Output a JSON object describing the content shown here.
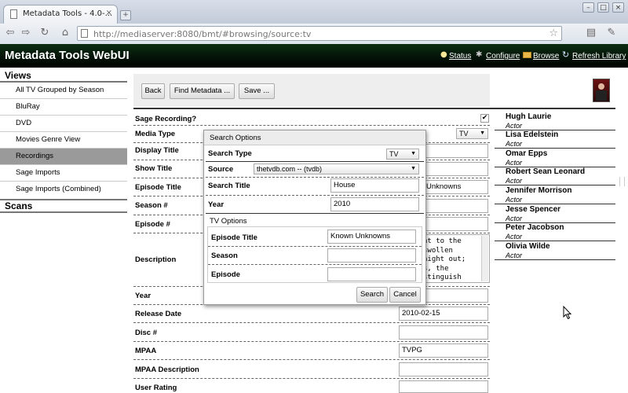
{
  "browser": {
    "tab_title": "Metadata Tools - 4.0-...",
    "tab_close": "×",
    "new_tab": "+",
    "url_host": "http://mediaserver",
    "url_path": ":8080/bmt/#browsing/source:tv"
  },
  "app": {
    "title": "Metadata Tools WebUI",
    "links": {
      "status": "Status",
      "configure": "Configure",
      "browse": "Browse",
      "refresh": "Refresh Library"
    }
  },
  "sidebar": {
    "views_heading": "Views",
    "items": [
      {
        "label": "All TV Grouped by Season"
      },
      {
        "label": "BluRay"
      },
      {
        "label": "DVD"
      },
      {
        "label": "Movies Genre View"
      },
      {
        "label": "Recordings",
        "selected": true
      },
      {
        "label": "Sage Imports"
      },
      {
        "label": "Sage Imports (Combined)"
      }
    ],
    "scans_heading": "Scans"
  },
  "toolbar": {
    "back": "Back",
    "find_metadata": "Find Metadata ...",
    "save": "Save ..."
  },
  "fields": {
    "sage_recording": "Sage Recording?",
    "sage_recording_checked": true,
    "checkmark": "✔",
    "media_type": "Media Type",
    "media_type_value": "TV",
    "display_title": "Display Title",
    "show_title": "Show Title",
    "episode_title": "Episode Title",
    "episode_title_value_partial": "Unknowns",
    "season": "Season #",
    "episode": "Episode #",
    "description": "Description",
    "description_lines": [
      "ht to the",
      "swollen",
      " night out;",
      "s, the",
      "stinguish"
    ],
    "year": "Year",
    "release_date": "Release Date",
    "release_date_value": "2010-02-15",
    "disc": "Disc #",
    "mpaa": "MPAA",
    "mpaa_value": "TVPG",
    "mpaa_description": "MPAA Description",
    "user_rating": "User Rating"
  },
  "cast": [
    {
      "name": "Hugh Laurie",
      "role": "Actor"
    },
    {
      "name": "Lisa Edelstein",
      "role": "Actor"
    },
    {
      "name": "Omar Epps",
      "role": "Actor"
    },
    {
      "name": "Robert Sean Leonard",
      "role": "Actor"
    },
    {
      "name": "Jennifer Morrison",
      "role": "Actor"
    },
    {
      "name": "Jesse Spencer",
      "role": "Actor"
    },
    {
      "name": "Peter Jacobson",
      "role": "Actor"
    },
    {
      "name": "Olivia Wilde",
      "role": "Actor"
    }
  ],
  "dialog": {
    "title": "Search Options",
    "search_type_label": "Search Type",
    "search_type_value": "TV",
    "source_label": "Source",
    "source_value": "thetvdb.com -- (tvdb)",
    "search_title_label": "Search Title",
    "search_title_value": "House",
    "year_label": "Year",
    "year_value": "2010",
    "tv_options_heading": "TV Options",
    "episode_title_label": "Episode Title",
    "episode_title_value": "Known Unknowns",
    "season_label": "Season",
    "season_value": "",
    "episode_label": "Episode",
    "episode_value": "",
    "search_button": "Search",
    "cancel_button": "Cancel"
  },
  "colors": {
    "header_bg": "#0b2d12",
    "selected_item": "#9a9a9a",
    "link": "#ffffff"
  },
  "icons": [
    "document-icon",
    "back-arrow-icon",
    "forward-arrow-icon",
    "reload-icon",
    "home-icon",
    "star-icon",
    "page-menu-icon",
    "wrench-icon",
    "status-bulb-icon",
    "configure-gear-icon",
    "browse-folder-icon",
    "refresh-icon",
    "poster-thumbnail",
    "dropdown-arrow-icon",
    "checkbox-icon",
    "mouse-cursor-icon"
  ]
}
